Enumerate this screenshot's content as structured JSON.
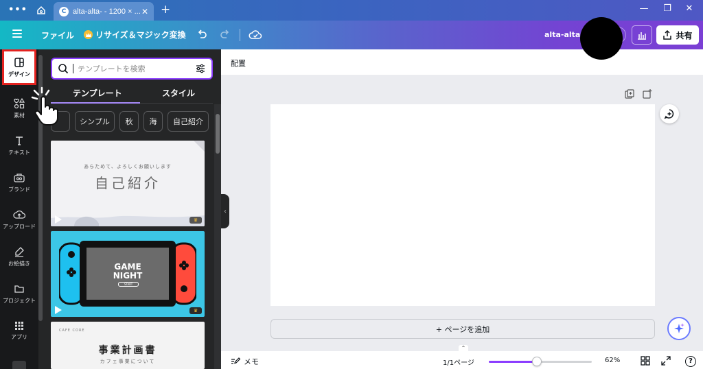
{
  "browser": {
    "tab_title": "alta-alta- - 1200 × ...",
    "tab_favicon": "C",
    "new_tab_label": "+",
    "close_label": "✕"
  },
  "header": {
    "file_label": "ファイル",
    "magic_resize_label": "リサイズ＆マジック変換",
    "doc_title": "alta-alta-",
    "share_label": "共有"
  },
  "rail": {
    "items": [
      {
        "label": "デザイン",
        "icon": "layout-icon",
        "active": true
      },
      {
        "label": "素材",
        "icon": "elements-icon"
      },
      {
        "label": "テキスト",
        "icon": "text-icon"
      },
      {
        "label": "ブランド",
        "icon": "brand-icon"
      },
      {
        "label": "アップロード",
        "icon": "upload-icon"
      },
      {
        "label": "お絵描き",
        "icon": "draw-icon"
      },
      {
        "label": "プロジェクト",
        "icon": "folder-icon"
      },
      {
        "label": "アプリ",
        "icon": "apps-icon"
      }
    ]
  },
  "panel": {
    "search_placeholder": "テンプレートを検索",
    "tabs": [
      "テンプレート",
      "スタイル"
    ],
    "active_tab": 0,
    "chips": [
      "シンプル",
      "秋",
      "海",
      "自己紹介"
    ],
    "templates": [
      {
        "subtitle": "あらためて、よろしくお願いします",
        "title": "自己紹介"
      },
      {
        "title_line1": "GAME",
        "title_line2": "NIGHT",
        "button": "START"
      },
      {
        "brand": "CAFE CORE",
        "title": "事業計画書",
        "subtitle": "カフェ事業について"
      }
    ]
  },
  "editor": {
    "position_label": "配置",
    "add_page_label": "+ ページを追加"
  },
  "footer": {
    "memo_label": "メモ",
    "pages_label": "1/1ページ",
    "zoom_label": "62%",
    "zoom_level": 0.62,
    "help_label": "?"
  },
  "colors": {
    "accent": "#8b3dff",
    "active_outline": "#e4221f",
    "header_gradient_start": "#14b8c5",
    "header_gradient_end": "#7a3fd4"
  }
}
